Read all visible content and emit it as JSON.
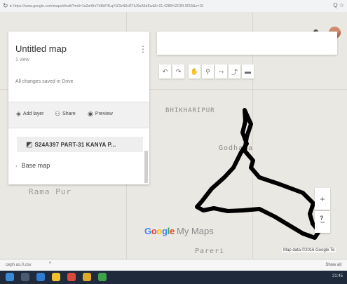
{
  "browser": {
    "nav_icon": "reload-icon",
    "url": "https://www.google.com/maps/d/edit?mid=1u2mWxYh8bP4LqYtZ3vN0cR7kJ9sA5dEw&ll=21.4286%2C84.9015&z=15",
    "right_icons": "Q ☆"
  },
  "panel": {
    "title": "Untitled map",
    "views": "1 view",
    "saved": "All changes saved in Drive",
    "menu_icon": "more-vert-icon",
    "actions": [
      {
        "label": "Add layer",
        "icon": "add-layer-icon"
      },
      {
        "label": "Share",
        "icon": "share-icon"
      },
      {
        "label": "Preview",
        "icon": "preview-icon"
      }
    ],
    "layer_name": "S24A397 PART-31 KANYA P...",
    "base_map": "Base map"
  },
  "toolbar": {
    "tools": [
      "undo-icon",
      "redo-icon",
      "hand-icon",
      "marker-icon",
      "draw-line-icon",
      "directions-icon",
      "ruler-icon"
    ]
  },
  "map": {
    "labels": [
      "BHIKHARIPUR",
      "Godhana",
      "Rama Pur",
      "Pareri"
    ],
    "boundary_color": "#000000"
  },
  "branding": {
    "google": "Google",
    "product": "My Maps",
    "attribution": "Map data ©2016 Google   Te"
  },
  "controls": {
    "zoom_in": "+",
    "zoom_out": "−",
    "help": "?"
  },
  "downloads": {
    "file": "ceph as.0.csv",
    "caret": "^",
    "show_all": "Show all"
  },
  "taskbar": {
    "clock": "21:45"
  }
}
